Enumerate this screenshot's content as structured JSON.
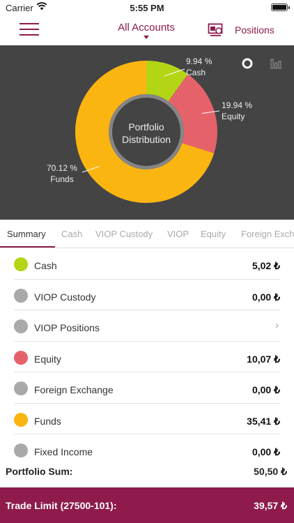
{
  "status_bar": {
    "carrier": "Carrier",
    "time": "5:55 PM"
  },
  "nav": {
    "accounts_label": "All Accounts",
    "positions_label": "Positions"
  },
  "chart_data": {
    "type": "pie",
    "title": "Portfolio Distribution",
    "categories": [
      "Cash",
      "Equity",
      "Funds"
    ],
    "values": [
      9.94,
      19.94,
      70.12
    ],
    "value_labels": [
      "9.94 %",
      "19.94 %",
      "70.12 %"
    ],
    "colors": [
      "#b2d615",
      "#e6626a",
      "#fbb511"
    ]
  },
  "tabs": [
    "Summary",
    "Cash",
    "VIOP Custody",
    "VIOP",
    "Equity",
    "Foreign Exch"
  ],
  "rows": [
    {
      "name": "Cash",
      "value": "5,02 ₺",
      "color": "#b2d615"
    },
    {
      "name": "VIOP Custody",
      "value": "0,00 ₺",
      "color": "#a9a9a9"
    },
    {
      "name": "VIOP Positions",
      "value": "",
      "color": "#a9a9a9",
      "chevron": "›"
    },
    {
      "name": "Equity",
      "value": "10,07 ₺",
      "color": "#e6626a"
    },
    {
      "name": "Foreign Exchange",
      "value": "0,00 ₺",
      "color": "#a9a9a9"
    },
    {
      "name": "Funds",
      "value": "35,41 ₺",
      "color": "#fbb511"
    },
    {
      "name": "Fixed Income",
      "value": "0,00 ₺",
      "color": "#a9a9a9"
    }
  ],
  "summary": {
    "label": "Portfolio Sum:",
    "value": "50,50 ₺"
  },
  "trade": {
    "label": "Trade Limit (27500-101):",
    "value": "39,57 ₺"
  },
  "colors": {
    "brand": "#8e1b4c",
    "chart_bg": "#444444"
  }
}
